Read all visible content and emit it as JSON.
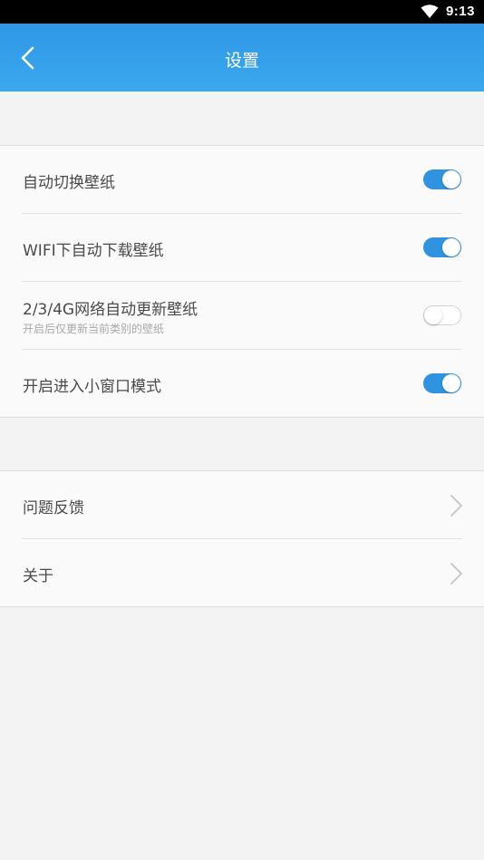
{
  "status_bar": {
    "time": "9:13",
    "wifi_icon": "wifi-icon"
  },
  "toolbar": {
    "back_icon": "back-arrow-icon",
    "title": "设置",
    "background": "#2f97e6"
  },
  "settings_group": {
    "items": [
      {
        "label": "自动切换壁纸",
        "subtitle": "",
        "enabled": true
      },
      {
        "label": "WIFI下自动下载壁纸",
        "subtitle": "",
        "enabled": true
      },
      {
        "label": "2/3/4G网络自动更新壁纸",
        "subtitle": "开启后仅更新当前类别的壁纸",
        "enabled": false
      },
      {
        "label": "开启进入小窗口模式",
        "subtitle": "",
        "enabled": true
      }
    ]
  },
  "info_group": {
    "items": [
      {
        "label": "问题反馈",
        "icon": "chevron-right-icon"
      },
      {
        "label": "关于",
        "icon": "chevron-right-icon"
      }
    ]
  },
  "colors": {
    "accent": "#2f93e0",
    "page_background": "#f3f3f3"
  }
}
